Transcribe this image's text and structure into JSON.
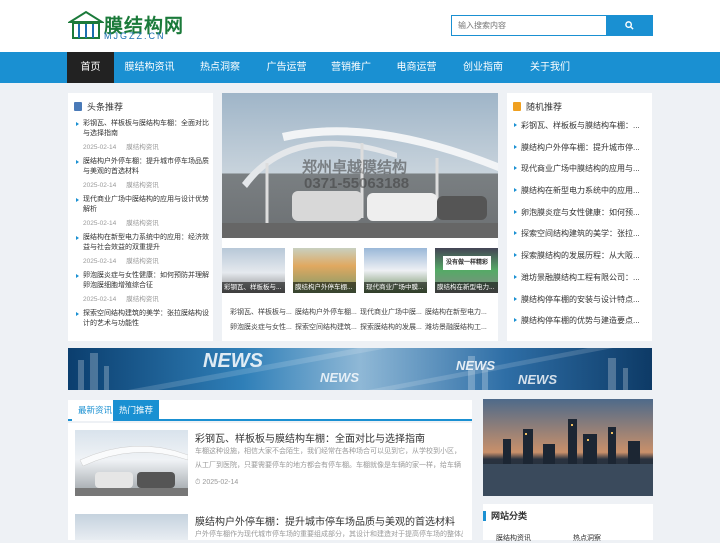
{
  "logo": {
    "name": "膜结构网",
    "sub": "MJGZZ.CN"
  },
  "search": {
    "placeholder": "输入搜索内容"
  },
  "nav": [
    "首页",
    "膜结构资讯",
    "热点洞察",
    "广告运营",
    "营销推广",
    "电商运营",
    "创业指南",
    "关于我们"
  ],
  "headlines": {
    "title": "头条推荐",
    "items": [
      {
        "title": "彩钢瓦、样板板与膜结构车棚：全面对比与选择指南",
        "date": "2025-02-14",
        "cat": "膜结构资讯"
      },
      {
        "title": "膜结构户外停车棚：提升城市停车场品质与美观的首选材料",
        "date": "2025-02-14",
        "cat": "膜结构资讯"
      },
      {
        "title": "现代商业广场中膜结构的应用与设计优势解析",
        "date": "2025-02-14",
        "cat": "膜结构资讯"
      },
      {
        "title": "膜结构在新型电力系统中的应用：经济效益与社会效益的双重提升",
        "date": "2025-02-14",
        "cat": "膜结构资讯"
      },
      {
        "title": "卵泡膜炎症与女性健康：如何预防并理解卵泡膜细胞增殖综合征",
        "date": "2025-02-14",
        "cat": "膜结构资讯"
      },
      {
        "title": "探索空间结构建筑的美学：张拉膜结构设计的艺术与功能性",
        "date": "",
        "cat": ""
      }
    ]
  },
  "slider": {
    "watermark1": "郑州卓越膜结构",
    "watermark2": "0371-55063188"
  },
  "thumbs": [
    {
      "cap": "彩钢瓦、样板板与..."
    },
    {
      "cap": "膜结构户外停车棚..."
    },
    {
      "cap": "现代商业广场中膜..."
    },
    {
      "cap": "膜结构在新型电力..."
    }
  ],
  "thumb_sign": "没有做一样精彩",
  "thumb_links": [
    "彩钢瓦、样板板与...",
    "膜结构户外停车棚...",
    "现代商业广场中膜...",
    "膜结构在新型电力...",
    "卵泡膜炎症与女性...",
    "探索空间结构建筑...",
    "探索膜结构的发展...",
    "潍坊景融膜结构工..."
  ],
  "random": {
    "title": "随机推荐",
    "items": [
      "彩钢瓦、样板板与膜结构车棚：...",
      "膜结构户外停车棚：提升城市停...",
      "现代商业广场中膜结构的应用与...",
      "膜结构在新型电力系统中的应用...",
      "卵泡膜炎症与女性健康：如何预...",
      "探索空间结构建筑的美学：张拉...",
      "探索膜结构的发展历程：从大阪...",
      "潍坊景融膜结构工程有限公司：...",
      "膜结构停车棚的安装与设计特点...",
      "膜结构停车棚的优势与建造要点..."
    ]
  },
  "banner": {
    "word": "NEWS"
  },
  "tabs": [
    "最新资讯",
    "热门推荐"
  ],
  "articles": [
    {
      "title": "彩钢瓦、样板板与膜结构车棚：全面对比与选择指南",
      "desc": "车棚这种设施，相信大家不会陌生，我们经常在各种场合可以见到它，从学校到小区，从工厂到医院，只要需要停车的地方都会有停车棚。车棚就像是车辆的家一样，给车辆提供遮风挡雨的空间。",
      "date": "2025-02-14"
    },
    {
      "title": "膜结构户外停车棚：提升城市停车场品质与美观的首选材料",
      "desc": "户外停车棚作为现代城市停车场的重要组成部分，其设计和建造对于提高停车场的整体品质至关重要。",
      "date": ""
    }
  ],
  "category": {
    "title": "网站分类",
    "items": [
      "膜结构资讯",
      "热点洞察"
    ]
  },
  "colors": {
    "primary": "#1a90d2",
    "nav_active": "#222222",
    "logo_green": "#1b7a3a"
  }
}
